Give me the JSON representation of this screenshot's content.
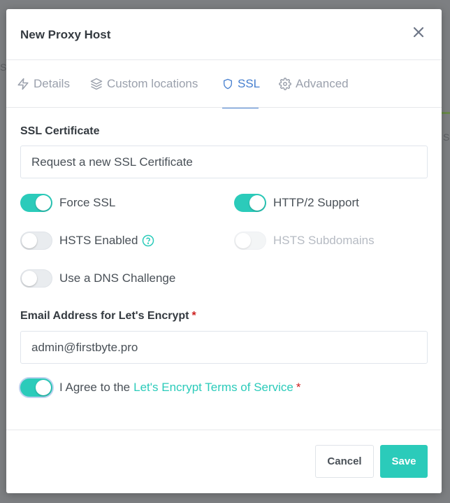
{
  "modal": {
    "title": "New Proxy Host"
  },
  "tabs": [
    {
      "label": "Details",
      "icon": "lightning-icon",
      "active": false
    },
    {
      "label": "Custom locations",
      "icon": "layers-icon",
      "active": false
    },
    {
      "label": "SSL",
      "icon": "shield-icon",
      "active": true
    },
    {
      "label": "Advanced",
      "icon": "gear-icon",
      "active": false
    }
  ],
  "ssl": {
    "certificate_label": "SSL Certificate",
    "certificate_value": "Request a new SSL Certificate",
    "force_ssl": {
      "label": "Force SSL",
      "on": true
    },
    "http2": {
      "label": "HTTP/2 Support",
      "on": true
    },
    "hsts": {
      "label": "HSTS Enabled",
      "on": false
    },
    "hsts_subdomains": {
      "label": "HSTS Subdomains",
      "on": false,
      "disabled": true
    },
    "dns_challenge": {
      "label": "Use a DNS Challenge",
      "on": false
    },
    "email_label": "Email Address for Let's Encrypt",
    "email_required": "*",
    "email_value": "admin@firstbyte.pro",
    "agree": {
      "prefix": "I Agree to the",
      "link": "Let's Encrypt Terms of Service",
      "required": "*",
      "on": true
    }
  },
  "footer": {
    "cancel_label": "Cancel",
    "save_label": "Save"
  },
  "background": {
    "fragment_left": "Sl",
    "fragment_right": "S"
  },
  "colors": {
    "accent": "#2bcbba",
    "tab_active": "#467fcf",
    "required": "#cd201f"
  }
}
